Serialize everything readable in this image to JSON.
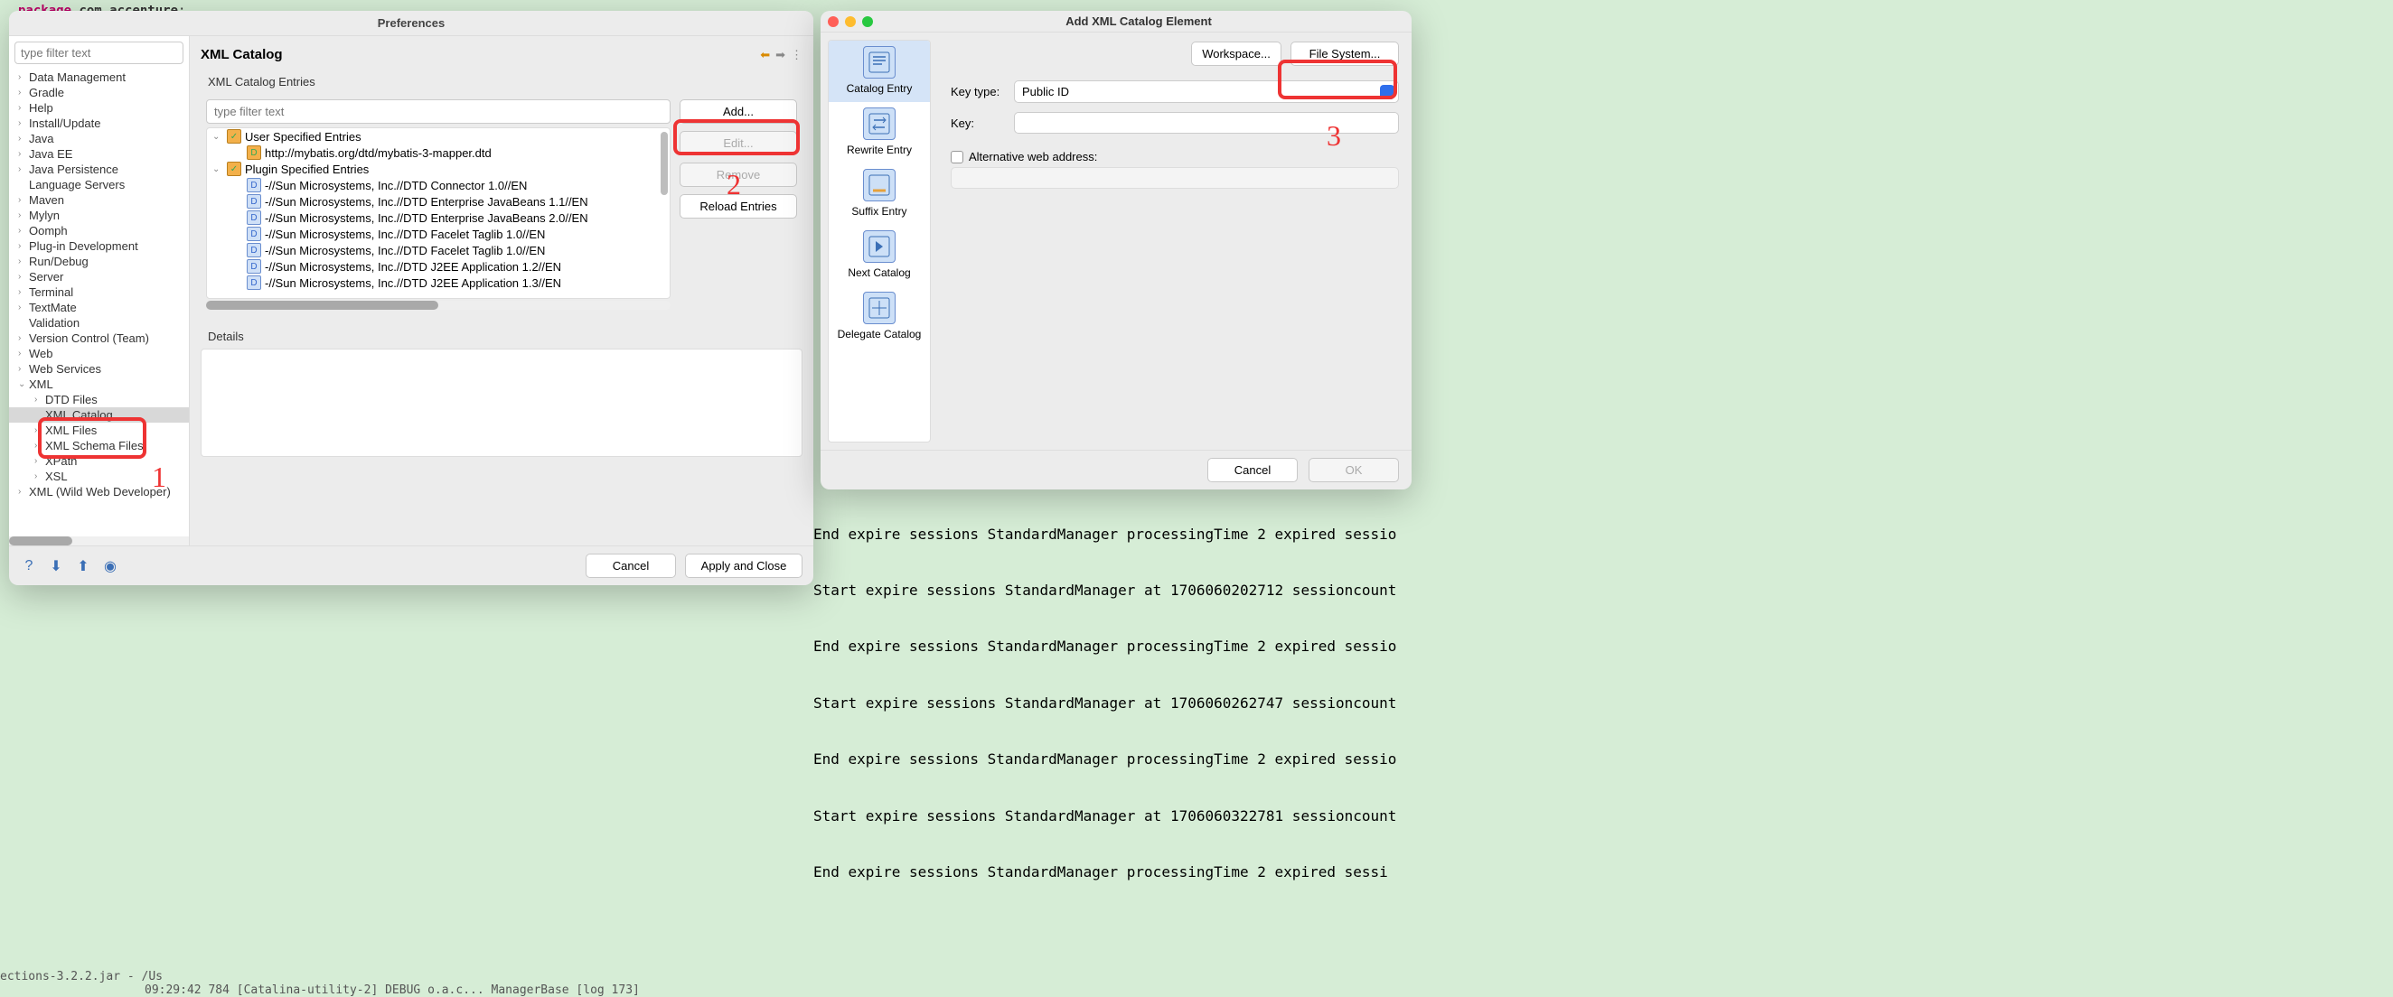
{
  "code_line": {
    "keyword": "package",
    "pkg": "com.accenture",
    "semi": ";"
  },
  "preferences": {
    "title": "Preferences",
    "filter_placeholder": "type filter text",
    "tree": [
      {
        "label": "Data Management",
        "expandable": true,
        "indent": 0
      },
      {
        "label": "Gradle",
        "expandable": true,
        "indent": 0
      },
      {
        "label": "Help",
        "expandable": true,
        "indent": 0
      },
      {
        "label": "Install/Update",
        "expandable": true,
        "indent": 0
      },
      {
        "label": "Java",
        "expandable": true,
        "indent": 0
      },
      {
        "label": "Java EE",
        "expandable": true,
        "indent": 0
      },
      {
        "label": "Java Persistence",
        "expandable": true,
        "indent": 0
      },
      {
        "label": "Language Servers",
        "expandable": false,
        "indent": 0
      },
      {
        "label": "Maven",
        "expandable": true,
        "indent": 0
      },
      {
        "label": "Mylyn",
        "expandable": true,
        "indent": 0
      },
      {
        "label": "Oomph",
        "expandable": true,
        "indent": 0
      },
      {
        "label": "Plug-in Development",
        "expandable": true,
        "indent": 0
      },
      {
        "label": "Run/Debug",
        "expandable": true,
        "indent": 0
      },
      {
        "label": "Server",
        "expandable": true,
        "indent": 0
      },
      {
        "label": "Terminal",
        "expandable": true,
        "indent": 0
      },
      {
        "label": "TextMate",
        "expandable": true,
        "indent": 0
      },
      {
        "label": "Validation",
        "expandable": false,
        "indent": 0
      },
      {
        "label": "Version Control (Team)",
        "expandable": true,
        "indent": 0
      },
      {
        "label": "Web",
        "expandable": true,
        "indent": 0
      },
      {
        "label": "Web Services",
        "expandable": true,
        "indent": 0
      },
      {
        "label": "XML",
        "expandable": true,
        "indent": 0,
        "expanded": true
      },
      {
        "label": "DTD Files",
        "expandable": true,
        "indent": 1,
        "obscured": true
      },
      {
        "label": "XML Catalog",
        "expandable": false,
        "indent": 1,
        "selected": true
      },
      {
        "label": "XML Files",
        "expandable": true,
        "indent": 1,
        "obscured": true
      },
      {
        "label": "XML Schema Files",
        "expandable": true,
        "indent": 1
      },
      {
        "label": "XPath",
        "expandable": true,
        "indent": 1
      },
      {
        "label": "XSL",
        "expandable": true,
        "indent": 1
      },
      {
        "label": "XML (Wild Web Developer)",
        "expandable": true,
        "indent": 0
      }
    ],
    "page_title": "XML Catalog",
    "entries_label": "XML Catalog Entries",
    "entries_filter_placeholder": "type filter text",
    "entries": [
      {
        "type": "group",
        "label": "User Specified Entries",
        "expanded": true
      },
      {
        "type": "leaf",
        "label": "http://mybatis.org/dtd/mybatis-3-mapper.dtd",
        "icon": "orange"
      },
      {
        "type": "group",
        "label": "Plugin Specified Entries",
        "expanded": true
      },
      {
        "type": "leaf",
        "label": "-//Sun Microsystems, Inc.//DTD Connector 1.0//EN",
        "icon": "blue"
      },
      {
        "type": "leaf",
        "label": "-//Sun Microsystems, Inc.//DTD Enterprise JavaBeans 1.1//EN",
        "icon": "blue"
      },
      {
        "type": "leaf",
        "label": "-//Sun Microsystems, Inc.//DTD Enterprise JavaBeans 2.0//EN",
        "icon": "blue"
      },
      {
        "type": "leaf",
        "label": "-//Sun Microsystems, Inc.//DTD Facelet Taglib 1.0//EN",
        "icon": "blue"
      },
      {
        "type": "leaf",
        "label": "-//Sun Microsystems, Inc.//DTD Facelet Taglib 1.0//EN",
        "icon": "blue"
      },
      {
        "type": "leaf",
        "label": "-//Sun Microsystems, Inc.//DTD J2EE Application 1.2//EN",
        "icon": "blue"
      },
      {
        "type": "leaf",
        "label": "-//Sun Microsystems, Inc.//DTD J2EE Application 1.3//EN",
        "icon": "blue"
      }
    ],
    "buttons": {
      "add": "Add...",
      "edit": "Edit...",
      "remove": "Remove",
      "reload": "Reload Entries"
    },
    "details_label": "Details",
    "footer": {
      "cancel": "Cancel",
      "apply": "Apply and Close"
    }
  },
  "addcatalog": {
    "title": "Add XML Catalog Element",
    "side": [
      {
        "label": "Catalog Entry",
        "selected": true
      },
      {
        "label": "Rewrite Entry"
      },
      {
        "label": "Suffix Entry"
      },
      {
        "label": "Next Catalog"
      },
      {
        "label": "Delegate Catalog"
      }
    ],
    "workspace_btn": "Workspace...",
    "filesystem_btn": "File System...",
    "keytype_label": "Key type:",
    "keytype_value": "Public ID",
    "key_label": "Key:",
    "altweb_label": "Alternative web address:",
    "footer": {
      "cancel": "Cancel",
      "ok": "OK"
    }
  },
  "annotations": {
    "one": "1",
    "two": "2",
    "three": "3"
  },
  "console": [
    "End expire sessions StandardManager processingTime 2 expired sessio",
    "Start expire sessions StandardManager at 1706060202712 sessioncount",
    "End expire sessions StandardManager processingTime 2 expired sessio",
    "Start expire sessions StandardManager at 1706060262747 sessioncount",
    "End expire sessions StandardManager processingTime 2 expired sessio",
    "Start expire sessions StandardManager at 1706060322781 sessioncount",
    "End expire sessions StandardManager processingTime 2 expired sessi"
  ],
  "bottom_left": "ections-3.2.2.jar - /Us",
  "bottom_code": "09:29:42 784 [Catalina-utility-2] DEBUG o.a.c... ManagerBase     [log 173]"
}
